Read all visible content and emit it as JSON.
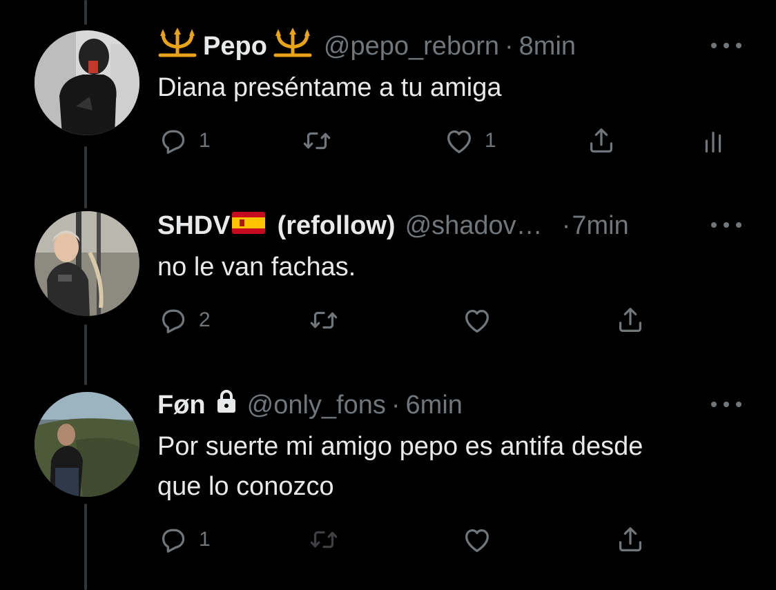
{
  "tweets": [
    {
      "name": "Pepo",
      "handle": "@pepo_reborn",
      "separator": "·",
      "time": "8min",
      "text": "Diana preséntame a tu amiga",
      "reply_count": "1",
      "like_count": "1",
      "name_emoji": "trident-emoji"
    },
    {
      "name": "SHDV",
      "name_suffix": "(refollow)",
      "handle": "@shadov…",
      "separator": "·",
      "time": "7min",
      "text": "no le van fachas.",
      "reply_count": "2",
      "name_emoji": "spain-flag-emoji"
    },
    {
      "name": "Føn",
      "handle": "@only_fons",
      "separator": "·",
      "time": "6min",
      "text_line1": "Por suerte mi amigo pepo es antifa desde",
      "text_line2": "que lo conozco",
      "reply_count": "1",
      "name_icon": "lock-icon"
    }
  ],
  "colors": {
    "background": "#000000",
    "primary_text": "#e7e9ea",
    "secondary_text": "#71767b",
    "thread_line": "#333639",
    "trident_gold": "#e8a317"
  }
}
